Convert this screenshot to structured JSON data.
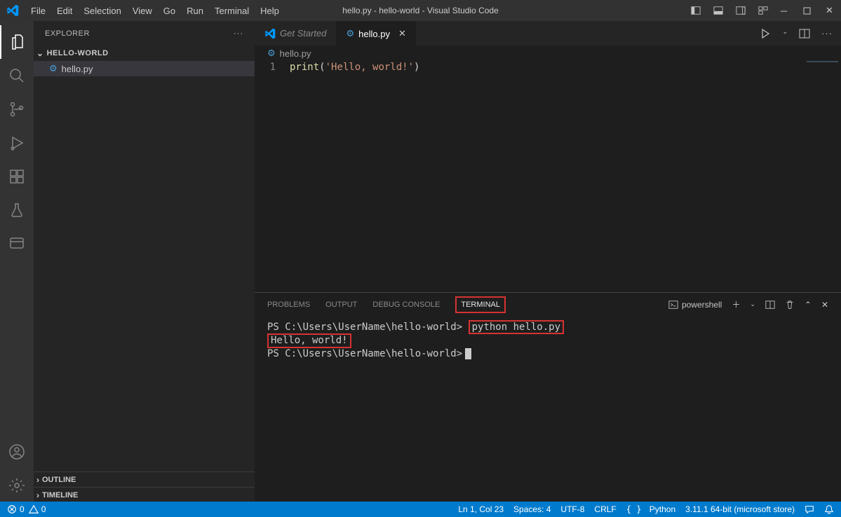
{
  "titlebar": {
    "menus": [
      "File",
      "Edit",
      "Selection",
      "View",
      "Go",
      "Run",
      "Terminal",
      "Help"
    ],
    "title": "hello.py - hello-world - Visual Studio Code"
  },
  "sidebar": {
    "title": "EXPLORER",
    "project": "HELLO-WORLD",
    "file": "hello.py",
    "outline": "OUTLINE",
    "timeline": "TIMELINE"
  },
  "tabs": {
    "getStarted": "Get Started",
    "hello": "hello.py"
  },
  "breadcrumb": "hello.py",
  "editor": {
    "lineNo": "1",
    "fn": "print",
    "paren1": "(",
    "str": "'Hello, world!'",
    "paren2": ")"
  },
  "panel": {
    "tabs": {
      "problems": "PROBLEMS",
      "output": "OUTPUT",
      "debug": "DEBUG CONSOLE",
      "terminal": "TERMINAL"
    },
    "shell": "powershell"
  },
  "terminal": {
    "prompt1": "PS C:\\Users\\UserName\\hello-world>",
    "command": "python hello.py",
    "output": "Hello, world!",
    "prompt2": "PS C:\\Users\\UserName\\hello-world>"
  },
  "status": {
    "errors": "0",
    "warnings": "0",
    "lncol": "Ln 1, Col 23",
    "spaces": "Spaces: 4",
    "encoding": "UTF-8",
    "eol": "CRLF",
    "lang": "Python",
    "interpreter": "3.11.1 64-bit (microsoft store)"
  }
}
